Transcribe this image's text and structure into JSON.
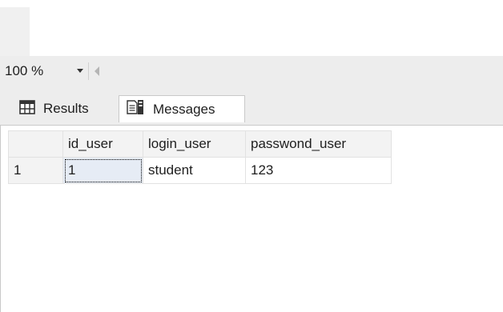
{
  "zoom": {
    "value": "100 %"
  },
  "tabs": [
    {
      "label": "Results",
      "icon": "grid-icon"
    },
    {
      "label": "Messages",
      "icon": "document-icon"
    }
  ],
  "grid": {
    "columns": [
      "id_user",
      "login_user",
      "passwond_user"
    ],
    "rows": [
      {
        "row_number": "1",
        "cells": [
          "1",
          "student",
          "123"
        ]
      }
    ]
  },
  "colors": {
    "toolbar_bg": "#ededed",
    "grid_border": "#e2e2e2",
    "selected_cell": "#e6ecf5"
  }
}
